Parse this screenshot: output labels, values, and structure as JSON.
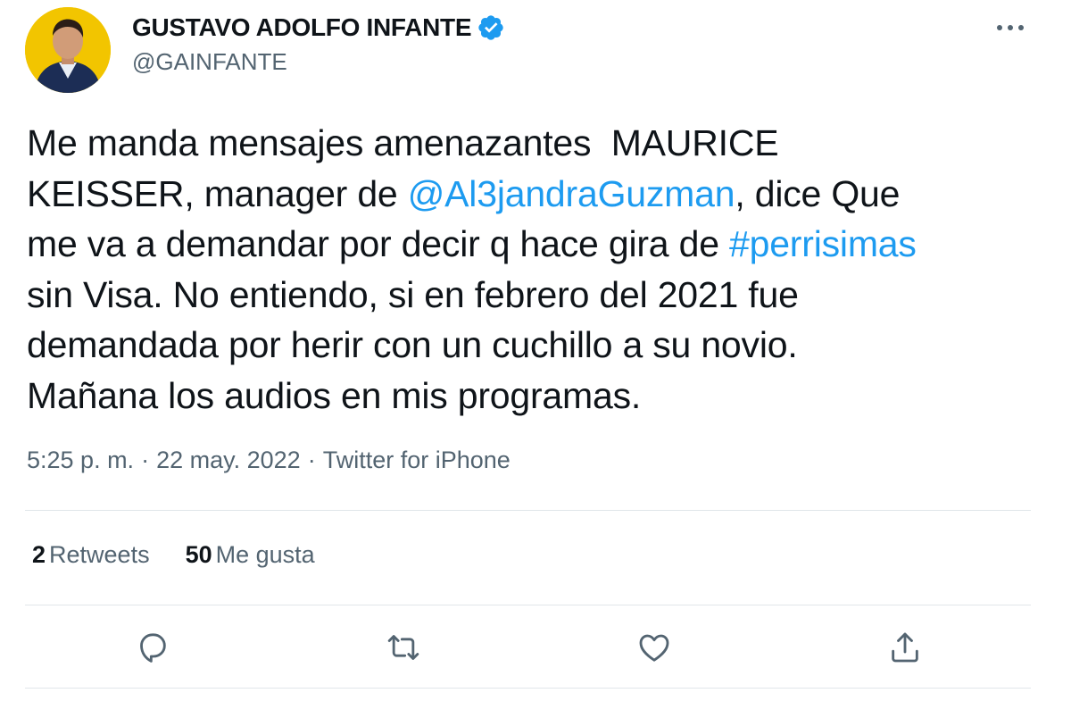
{
  "author": {
    "display_name": "GUSTAVO ADOLFO INFANTE",
    "handle": "@GAINFANTE",
    "verified": true
  },
  "tweet": {
    "text_parts": [
      "Me manda mensajes amenazantes  MAURICE\nKEISSER, manager de ",
      "@Al3jandraGuzman",
      ", dice Que\nme va a demandar por decir q hace gira de ",
      "#perrisimas",
      "\nsin Visa. No entiendo, si en febrero del 2021 fue\ndemandada por herir con un cuchillo a su novio.\nMañana los audios en mis programas."
    ]
  },
  "meta": {
    "time": "5:25 p. m.",
    "separator": "·",
    "date": "22 may. 2022",
    "source": "Twitter for iPhone"
  },
  "stats": {
    "retweets_count": "2",
    "retweets_label": "Retweets",
    "likes_count": "50",
    "likes_label": "Me gusta"
  },
  "actions": {
    "icons": [
      "reply-icon",
      "retweet-icon",
      "like-icon",
      "share-icon"
    ]
  },
  "colors": {
    "link": "#1d9bf0",
    "secondary_text": "#536471",
    "primary_text": "#0f1419",
    "avatar_bg": "#f2c500"
  }
}
